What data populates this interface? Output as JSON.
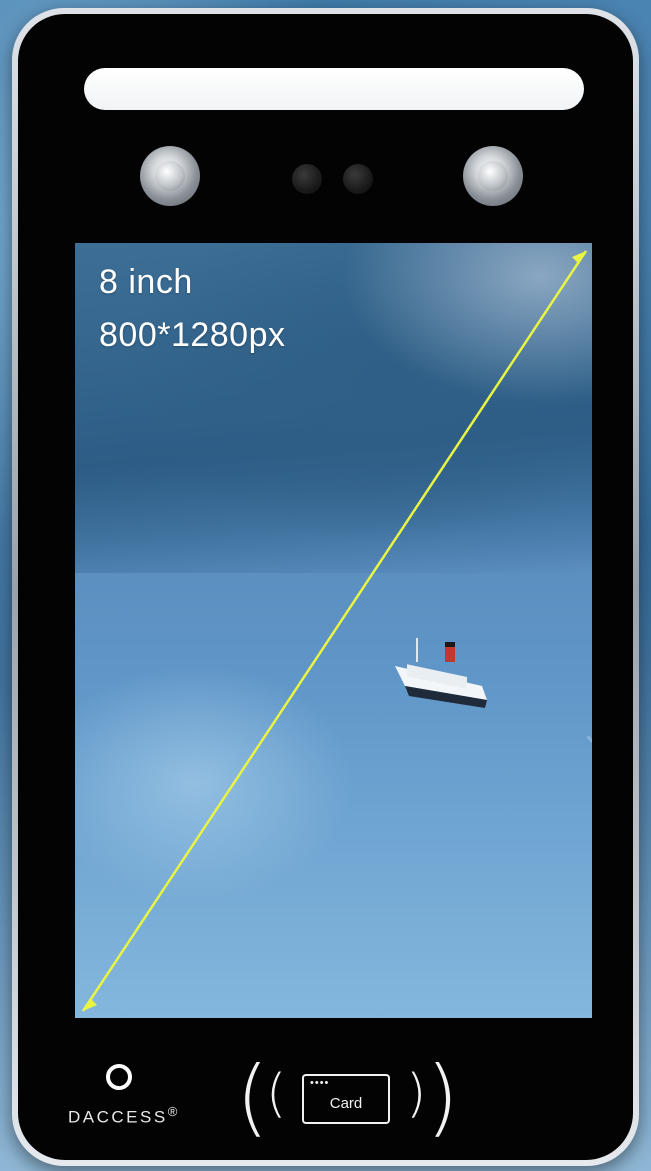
{
  "screen": {
    "size_label": "8 inch",
    "resolution_label": "800*1280px"
  },
  "card_reader": {
    "label": "Card",
    "dots": "••••"
  },
  "brand": {
    "name": "DACCESS",
    "mark": "®"
  },
  "colors": {
    "bezel": "#030303",
    "frame": "#c8ccd1",
    "diagonal_line": "#e9f542",
    "light_bar": "#f5f6f7"
  }
}
